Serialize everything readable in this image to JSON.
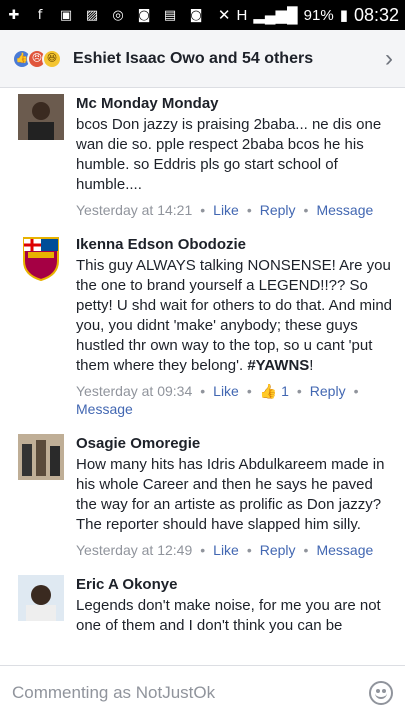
{
  "status": {
    "battery": "91%",
    "time": "08:32",
    "network": "H"
  },
  "reactions": {
    "text": "Eshiet Isaac Owo and 54 others"
  },
  "comments": [
    {
      "name": "Mc Monday Monday",
      "text": "bcos Don jazzy is praising 2baba... ne dis one wan die so.  pple respect 2baba bcos he his humble.  so Eddris pls go start school of humble....",
      "time": "Yesterday at 14:21",
      "like": "Like",
      "reply": "Reply",
      "message": "Message"
    },
    {
      "name": "Ikenna Edson Obodozie",
      "text": "This guy ALWAYS talking NONSENSE! Are you the one to brand yourself a LEGEND!!?? So petty! U shd wait for others to do that. And mind you, you didnt 'make' anybody; these guys hustled thr own way to the top, so u cant 'put them where they belong'.",
      "hashtag": "#YAWNS",
      "hashtag_suffix": "!",
      "time": "Yesterday at 09:34",
      "like": "Like",
      "like_count": "1",
      "reply": "Reply",
      "message": "Message"
    },
    {
      "name": "Osagie Omoregie",
      "text": "How many hits has Idris Abdulkareem made in his whole Career and then he says he paved the way for an  artiste as prolific as Don jazzy? The reporter should have slapped him silly.",
      "time": "Yesterday at 12:49",
      "like": "Like",
      "reply": "Reply",
      "message": "Message"
    },
    {
      "name": "Eric A Okonye",
      "text": "Legends don't make noise, for me you are not one of them and I don't think you can be"
    }
  ],
  "composer": {
    "placeholder": "Commenting as NotJustOk"
  }
}
